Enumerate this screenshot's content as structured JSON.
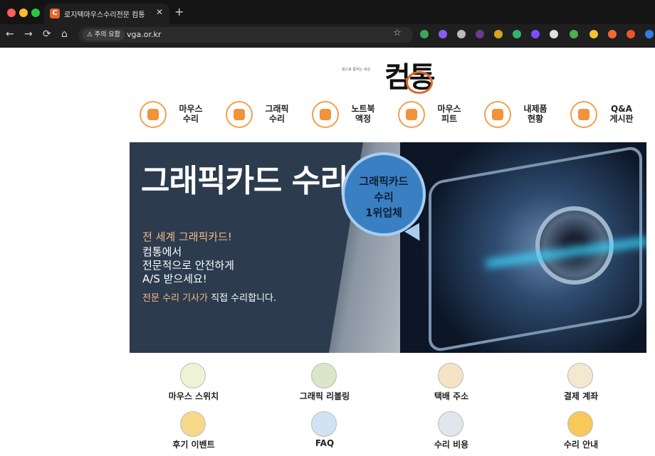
{
  "browser": {
    "tab_title": "로지텍마우스수리전문 컴통",
    "favicon_letter": "C",
    "new_tab": "+",
    "close": "✕",
    "warning_chip": "⚠ 주의 요함",
    "url": "vga.or.kr",
    "star": "☆",
    "nav": {
      "back": "←",
      "forward": "→",
      "reload": "⟳",
      "home": "⌂"
    }
  },
  "logo": {
    "tagline": "컴으로 통하는 세상",
    "text": "컴통"
  },
  "menu": [
    {
      "line1": "마우스",
      "line2": "수리"
    },
    {
      "line1": "그래픽",
      "line2": "수리"
    },
    {
      "line1": "노트북",
      "line2": "액정"
    },
    {
      "line1": "마우스",
      "line2": "피트"
    },
    {
      "line1": "내제품",
      "line2": "현황"
    },
    {
      "line1": "Q&A",
      "line2": "게시판"
    }
  ],
  "banner": {
    "headline": "그래픽카드 수리",
    "bubble": {
      "line1": "그래픽카드",
      "line2": "수리",
      "line3": "1위업체"
    },
    "copy": {
      "line1": "전 세계 그래픽카드!",
      "line2": "컴통에서",
      "line3": "전문적으로 안전하게",
      "line4": "A/S 받으세요!",
      "line5_highlight": "전문 수리 기사가",
      "line5_rest": " 직접 수리합니다."
    }
  },
  "quick_links": [
    {
      "label": "마우스 스위치"
    },
    {
      "label": "그래픽 리볼링"
    },
    {
      "label": "택배 주소"
    },
    {
      "label": "결제 계좌"
    },
    {
      "label": "후기 이벤트"
    },
    {
      "label": "FAQ"
    },
    {
      "label": "수리 비용"
    },
    {
      "label": "수리 안내"
    }
  ],
  "colors": {
    "accent": "#e8632b",
    "menu_ring": "#f0a24b",
    "bubble": "#3b7fc3"
  }
}
